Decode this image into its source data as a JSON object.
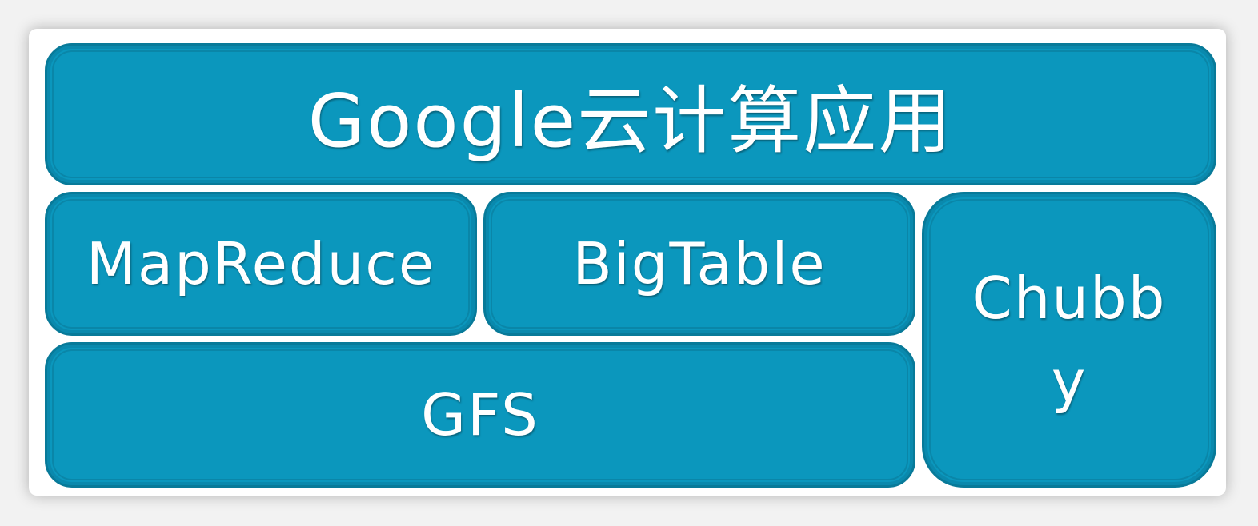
{
  "diagram": {
    "top_block": "Google云计算应用",
    "mapreduce": "MapReduce",
    "bigtable": "BigTable",
    "gfs": "GFS",
    "chubby_line1": "Chubb",
    "chubby_line2": "y"
  },
  "colors": {
    "block_fill": "#0b97bd",
    "block_border": "#087a99",
    "text": "#ffffff"
  }
}
